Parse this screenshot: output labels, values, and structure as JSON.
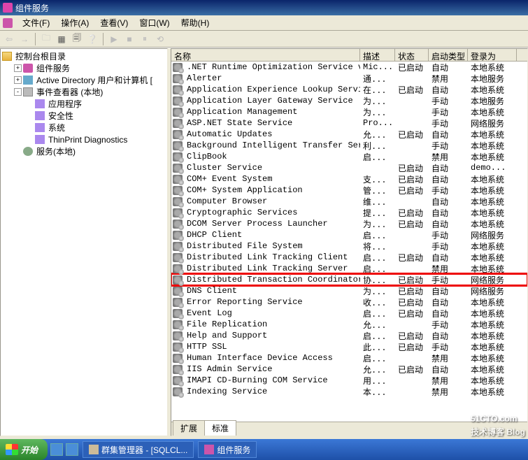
{
  "window": {
    "title": "组件服务"
  },
  "menu": {
    "file": "文件(F)",
    "action": "操作(A)",
    "view": "查看(V)",
    "window": "窗口(W)",
    "help": "帮助(H)"
  },
  "tree": {
    "root": "控制台根目录",
    "items": [
      {
        "label": "组件服务",
        "exp": "+"
      },
      {
        "label": "Active Directory 用户和计算机 [",
        "exp": "+"
      },
      {
        "label": "事件查看器 (本地)",
        "exp": "-"
      },
      {
        "label": "应用程序",
        "indent": 2
      },
      {
        "label": "安全性",
        "indent": 2
      },
      {
        "label": "系统",
        "indent": 2
      },
      {
        "label": "ThinPrint Diagnostics",
        "indent": 2
      },
      {
        "label": "服务(本地)"
      }
    ]
  },
  "columns": {
    "name": "名称",
    "desc": "描述",
    "status": "状态",
    "startup": "启动类型",
    "logon": "登录为"
  },
  "services": [
    {
      "name": ".NET Runtime Optimization Service v...",
      "desc": "Mic...",
      "status": "已启动",
      "startup": "自动",
      "logon": "本地系统"
    },
    {
      "name": "Alerter",
      "desc": "通...",
      "status": "",
      "startup": "禁用",
      "logon": "本地服务"
    },
    {
      "name": "Application Experience Lookup Service",
      "desc": "在...",
      "status": "已启动",
      "startup": "自动",
      "logon": "本地系统"
    },
    {
      "name": "Application Layer Gateway Service",
      "desc": "为...",
      "status": "",
      "startup": "手动",
      "logon": "本地服务"
    },
    {
      "name": "Application Management",
      "desc": "为...",
      "status": "",
      "startup": "手动",
      "logon": "本地系统"
    },
    {
      "name": "ASP.NET State Service",
      "desc": "Pro...",
      "status": "",
      "startup": "手动",
      "logon": "网络服务"
    },
    {
      "name": "Automatic Updates",
      "desc": "允...",
      "status": "已启动",
      "startup": "自动",
      "logon": "本地系统"
    },
    {
      "name": "Background Intelligent Transfer Ser...",
      "desc": "利...",
      "status": "",
      "startup": "手动",
      "logon": "本地系统"
    },
    {
      "name": "ClipBook",
      "desc": "启...",
      "status": "",
      "startup": "禁用",
      "logon": "本地系统"
    },
    {
      "name": "Cluster Service",
      "desc": "",
      "status": "已启动",
      "startup": "自动",
      "logon": "demo..."
    },
    {
      "name": "COM+ Event System",
      "desc": "支...",
      "status": "已启动",
      "startup": "自动",
      "logon": "本地系统"
    },
    {
      "name": "COM+ System Application",
      "desc": "管...",
      "status": "已启动",
      "startup": "手动",
      "logon": "本地系统"
    },
    {
      "name": "Computer Browser",
      "desc": "维...",
      "status": "",
      "startup": "自动",
      "logon": "本地系统"
    },
    {
      "name": "Cryptographic Services",
      "desc": "提...",
      "status": "已启动",
      "startup": "自动",
      "logon": "本地系统"
    },
    {
      "name": "DCOM Server Process Launcher",
      "desc": "为...",
      "status": "已启动",
      "startup": "自动",
      "logon": "本地系统"
    },
    {
      "name": "DHCP Client",
      "desc": "启...",
      "status": "",
      "startup": "手动",
      "logon": "网络服务"
    },
    {
      "name": "Distributed File System",
      "desc": "将...",
      "status": "",
      "startup": "手动",
      "logon": "本地系统"
    },
    {
      "name": "Distributed Link Tracking Client",
      "desc": "启...",
      "status": "已启动",
      "startup": "自动",
      "logon": "本地系统"
    },
    {
      "name": "Distributed Link Tracking Server",
      "desc": "启...",
      "status": "",
      "startup": "禁用",
      "logon": "本地系统"
    },
    {
      "name": "Distributed Transaction Coordinator",
      "desc": "协...",
      "status": "已启动",
      "startup": "手动",
      "logon": "网络服务",
      "highlight": true
    },
    {
      "name": "DNS Client",
      "desc": "为...",
      "status": "已启动",
      "startup": "自动",
      "logon": "网络服务"
    },
    {
      "name": "Error Reporting Service",
      "desc": "收...",
      "status": "已启动",
      "startup": "自动",
      "logon": "本地系统"
    },
    {
      "name": "Event Log",
      "desc": "启...",
      "status": "已启动",
      "startup": "自动",
      "logon": "本地系统"
    },
    {
      "name": "File Replication",
      "desc": "允...",
      "status": "",
      "startup": "手动",
      "logon": "本地系统"
    },
    {
      "name": "Help and Support",
      "desc": "启...",
      "status": "已启动",
      "startup": "自动",
      "logon": "本地系统"
    },
    {
      "name": "HTTP SSL",
      "desc": "此...",
      "status": "已启动",
      "startup": "手动",
      "logon": "本地系统"
    },
    {
      "name": "Human Interface Device Access",
      "desc": "启...",
      "status": "",
      "startup": "禁用",
      "logon": "本地系统"
    },
    {
      "name": "IIS Admin Service",
      "desc": "允...",
      "status": "已启动",
      "startup": "自动",
      "logon": "本地系统"
    },
    {
      "name": "IMAPI CD-Burning COM Service",
      "desc": "用...",
      "status": "",
      "startup": "禁用",
      "logon": "本地系统"
    },
    {
      "name": "Indexing Service",
      "desc": "本...",
      "status": "",
      "startup": "禁用",
      "logon": "本地系统"
    }
  ],
  "tabs": {
    "extended": "扩展",
    "standard": "标准"
  },
  "taskbar": {
    "start": "开始",
    "item1": "群集管理器 - [SQLCL...",
    "item2": "组件服务"
  },
  "watermark": {
    "main": "51CTO.com",
    "sub": "技术博客  Blog"
  }
}
